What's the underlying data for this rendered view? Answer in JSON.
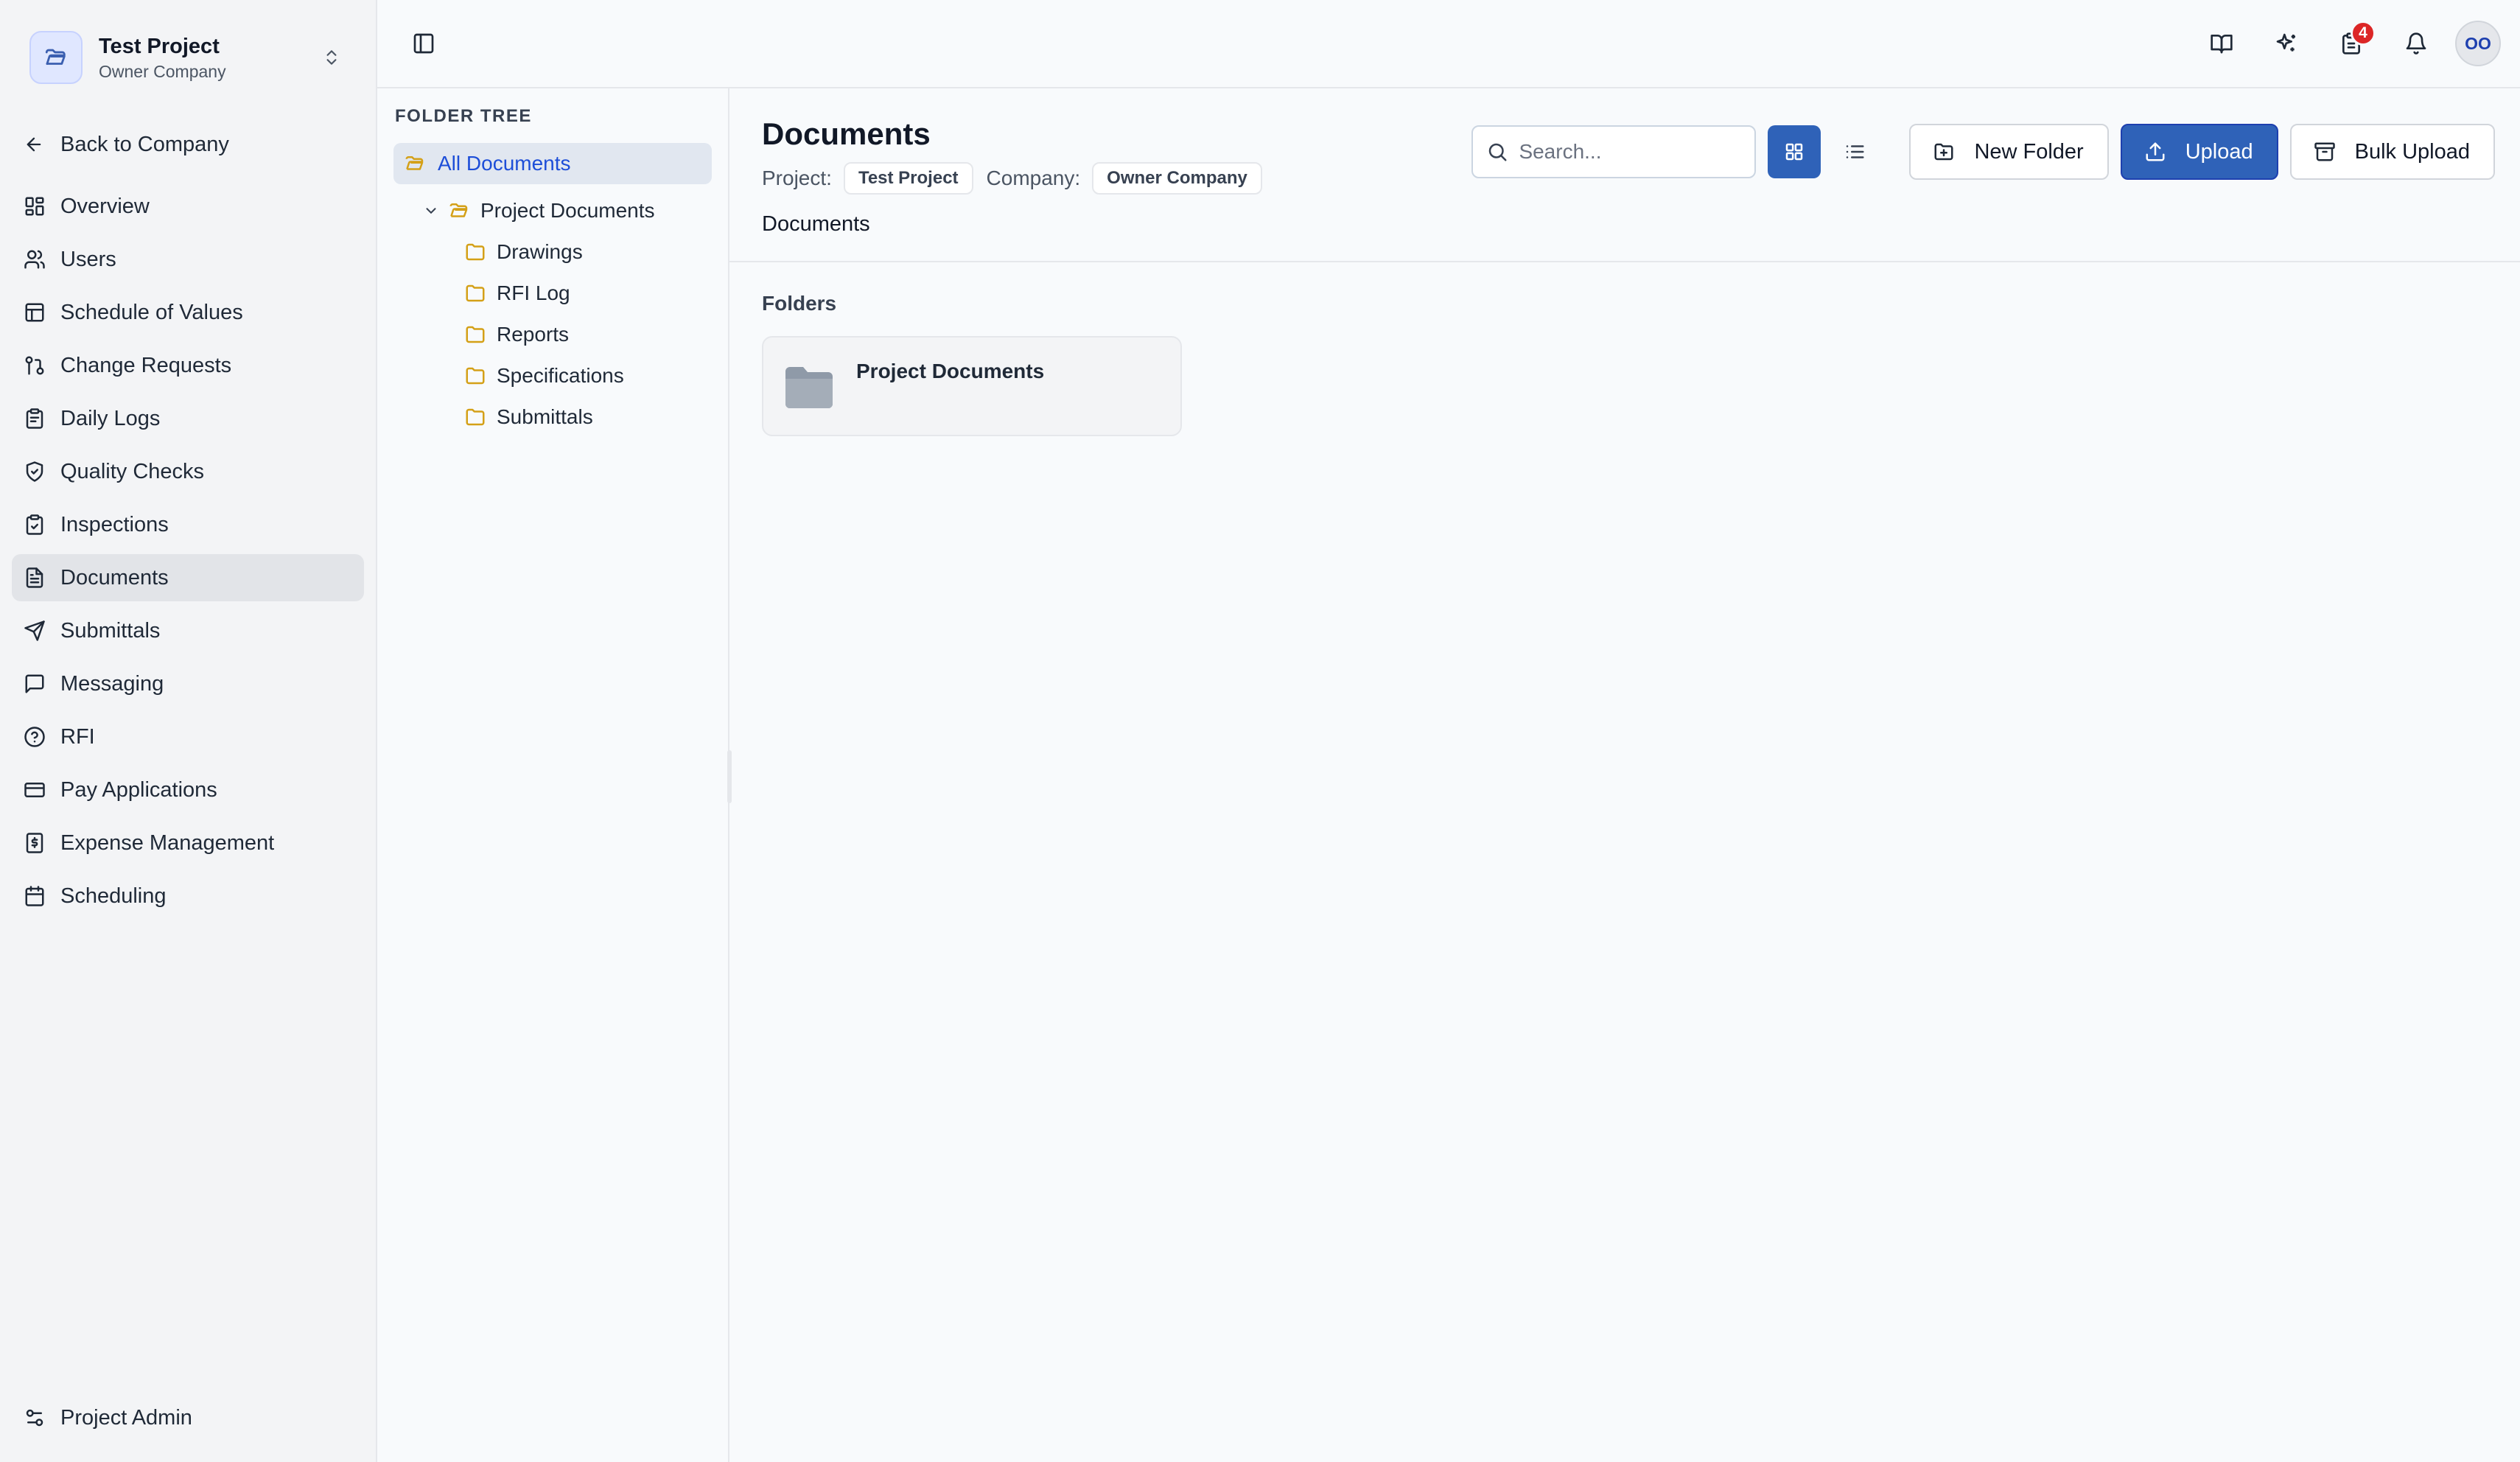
{
  "project": {
    "name": "Test Project",
    "company": "Owner Company"
  },
  "sidebar": {
    "back_label": "Back to Company",
    "items": [
      {
        "label": "Overview",
        "icon": "grid-icon"
      },
      {
        "label": "Users",
        "icon": "users-icon"
      },
      {
        "label": "Schedule of Values",
        "icon": "table-icon"
      },
      {
        "label": "Change Requests",
        "icon": "git-compare-icon"
      },
      {
        "label": "Daily Logs",
        "icon": "clipboard-icon"
      },
      {
        "label": "Quality Checks",
        "icon": "shield-check-icon"
      },
      {
        "label": "Inspections",
        "icon": "clipboard-check-icon"
      },
      {
        "label": "Documents",
        "icon": "file-text-icon",
        "active": true
      },
      {
        "label": "Submittals",
        "icon": "send-icon"
      },
      {
        "label": "Messaging",
        "icon": "message-icon"
      },
      {
        "label": "RFI",
        "icon": "help-circle-icon"
      },
      {
        "label": "Pay Applications",
        "icon": "credit-card-icon"
      },
      {
        "label": "Expense Management",
        "icon": "receipt-icon"
      },
      {
        "label": "Scheduling",
        "icon": "calendar-icon"
      }
    ],
    "admin_label": "Project Admin"
  },
  "topbar": {
    "notifications_count": "4",
    "user_initials": "OO"
  },
  "tree": {
    "title": "FOLDER TREE",
    "root": "All Documents",
    "folder": "Project Documents",
    "children": [
      "Drawings",
      "RFI Log",
      "Reports",
      "Specifications",
      "Submittals"
    ]
  },
  "header": {
    "title": "Documents",
    "project_label": "Project:",
    "project_value": "Test Project",
    "company_label": "Company:",
    "company_value": "Owner Company",
    "breadcrumb": "Documents",
    "search_placeholder": "Search...",
    "new_folder_label": "New Folder",
    "upload_label": "Upload",
    "bulk_upload_label": "Bulk Upload"
  },
  "content": {
    "folders_title": "Folders",
    "folders": [
      "Project Documents"
    ]
  },
  "colors": {
    "primary": "#2f62b8",
    "badge": "#dc2626",
    "folder_accent": "#d4a017"
  }
}
